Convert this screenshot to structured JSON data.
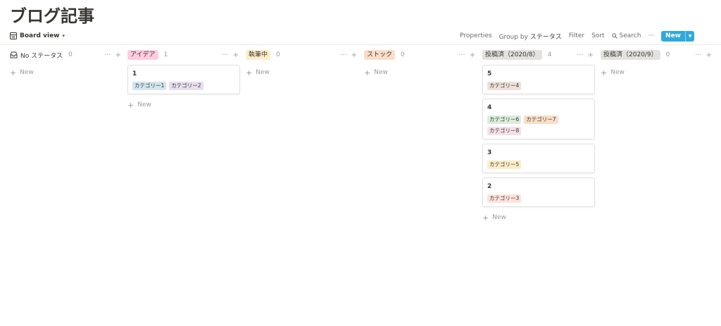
{
  "page": {
    "title": "ブログ記事"
  },
  "view": {
    "label": "Board view",
    "chevron": "▾"
  },
  "toolbar": {
    "properties": "Properties",
    "group_by_label": "Group by",
    "group_by_value": "ステータス",
    "filter": "Filter",
    "sort": "Sort",
    "search": "Search",
    "more": "···",
    "new_label": "New",
    "new_arrow": "▼",
    "new_color": "#2eaadc"
  },
  "board": {
    "add_new_label": "New",
    "plus": "+",
    "more": "···",
    "columns": [
      {
        "label": "No ステータス",
        "count": "0",
        "tag_color": "",
        "icon": "inbox-icon",
        "cards": []
      },
      {
        "label": "アイデア",
        "count": "1",
        "tag_color": "#ffcce0",
        "cards": [
          {
            "title": "1",
            "chips": [
              {
                "label": "カテゴリー1",
                "color": "#d3e5ef"
              },
              {
                "label": "カテゴリー2",
                "color": "#e8deee"
              }
            ]
          }
        ]
      },
      {
        "label": "執筆中",
        "count": "0",
        "tag_color": "#fdecc8",
        "cards": []
      },
      {
        "label": "ストック",
        "count": "0",
        "tag_color": "#fadec9",
        "cards": []
      },
      {
        "label": "投稿済（2020/8）",
        "count": "4",
        "tag_color": "#e3e2e0",
        "cards": [
          {
            "title": "5",
            "chips": [
              {
                "label": "カテゴリー4",
                "color": "#eee0da"
              }
            ]
          },
          {
            "title": "4",
            "chips": [
              {
                "label": "カテゴリー6",
                "color": "#dbeddb"
              },
              {
                "label": "カテゴリー7",
                "color": "#fadec9"
              },
              {
                "label": "カテゴリー8",
                "color": "#f5e0e9"
              }
            ]
          },
          {
            "title": "3",
            "chips": [
              {
                "label": "カテゴリー5",
                "color": "#fdecc8"
              }
            ]
          },
          {
            "title": "2",
            "chips": [
              {
                "label": "カテゴリー3",
                "color": "#ffe2dd"
              }
            ]
          }
        ]
      },
      {
        "label": "投稿済（2020/9）",
        "count": "0",
        "tag_color": "#e3e2e0",
        "cards": []
      }
    ]
  }
}
